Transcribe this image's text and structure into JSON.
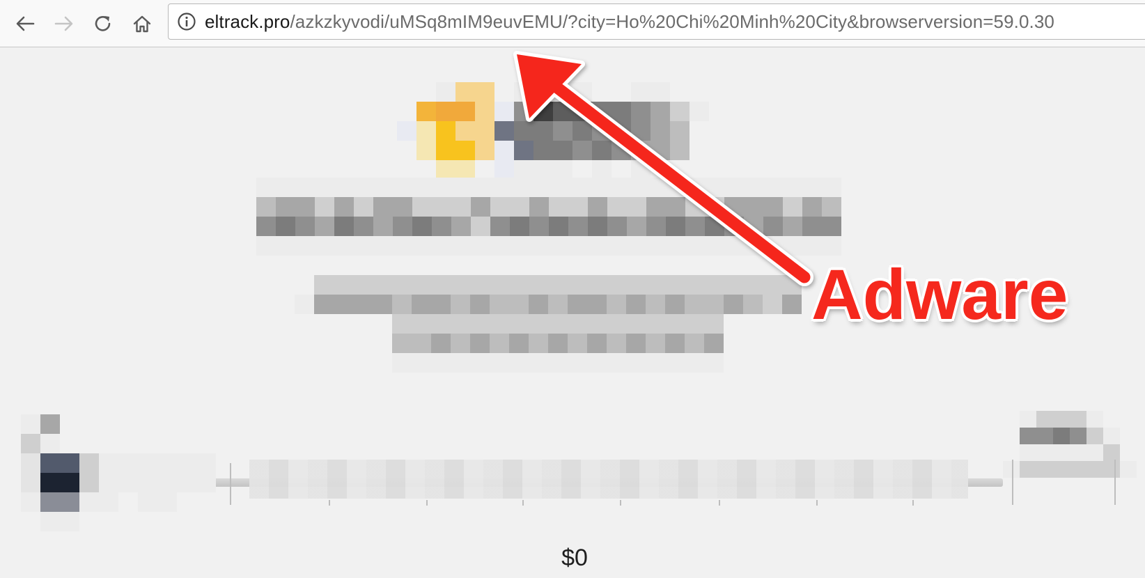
{
  "browser": {
    "url_domain": "eltrack.pro",
    "url_path": "/azkzkyvodi/uMSq8mIM9euvEMU/?city=Ho%20Chi%20Minh%20City&browserversion=59.0.30"
  },
  "page": {
    "price_label": "$0"
  },
  "annotation": {
    "label": "Adware",
    "color": "#f5281d"
  },
  "icons": {
    "back": "back-arrow-icon",
    "forward": "forward-arrow-icon",
    "reload": "reload-icon",
    "home": "home-icon",
    "info": "info-icon"
  },
  "colors": {
    "toolbar_bg": "#f9f9f9",
    "page_bg": "#f1f1f1",
    "logo_yellow": "#f8c31e",
    "annotation_red": "#f5281d"
  }
}
